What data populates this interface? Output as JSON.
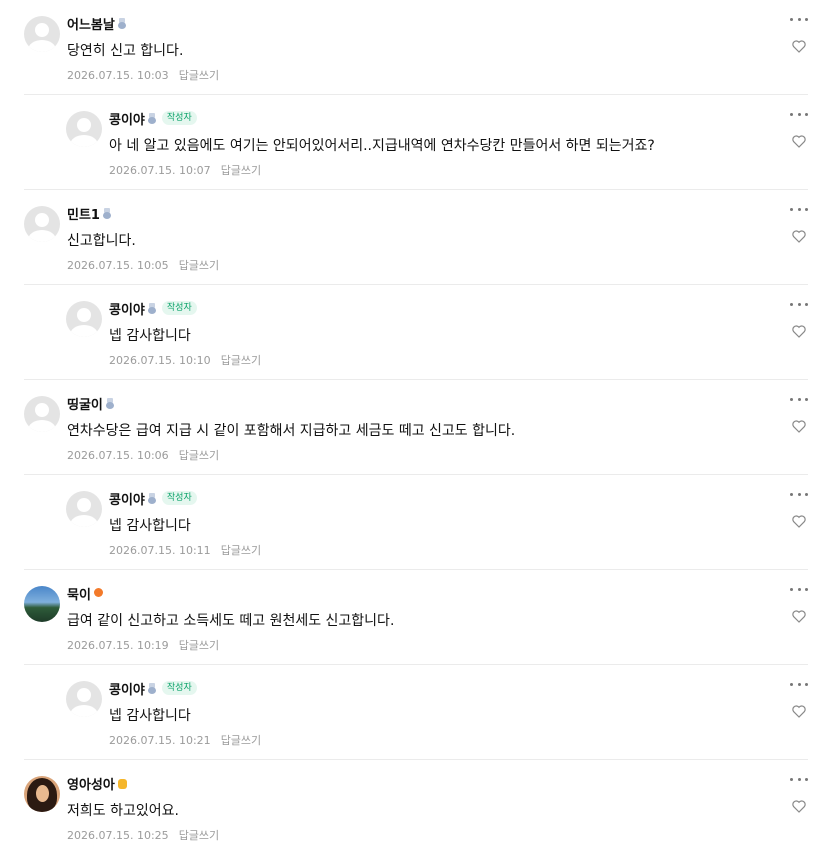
{
  "reply_label": "답글쓰기",
  "author_tag": "작성자",
  "comments": [
    {
      "author": "어느봄날",
      "badge": "blue",
      "avatar": "default",
      "text": "당연히 신고 합니다.",
      "date": "2026.07.15. 10:03"
    },
    {
      "author": "콩이야",
      "badge": "blue",
      "avatar": "default",
      "is_author": true,
      "text": "아 네 알고 있음에도 여기는 안되어있어서리..지급내역에 연차수당칸 만들어서 하면 되는거죠?",
      "date": "2026.07.15. 10:07"
    },
    {
      "author": "민트1",
      "badge": "blue",
      "avatar": "default",
      "text": "신고합니다.",
      "date": "2026.07.15. 10:05"
    },
    {
      "author": "콩이야",
      "badge": "blue",
      "avatar": "default",
      "is_author": true,
      "text": "넵 감사합니다",
      "date": "2026.07.15. 10:10"
    },
    {
      "author": "띵굴이",
      "badge": "blue",
      "avatar": "default",
      "text": "연차수당은 급여 지급 시 같이 포함해서 지급하고 세금도 떼고 신고도 합니다.",
      "date": "2026.07.15. 10:06"
    },
    {
      "author": "콩이야",
      "badge": "blue",
      "avatar": "default",
      "is_author": true,
      "text": "넵 감사합니다",
      "date": "2026.07.15. 10:11"
    },
    {
      "author": "묵이",
      "badge": "orange",
      "avatar": "scenic",
      "text": "급여 같이 신고하고 소득세도 떼고 원천세도 신고합니다.",
      "date": "2026.07.15. 10:19"
    },
    {
      "author": "콩이야",
      "badge": "blue",
      "avatar": "default",
      "is_author": true,
      "text": "넵 감사합니다",
      "date": "2026.07.15. 10:21"
    },
    {
      "author": "영아성아",
      "badge": "yellow",
      "avatar": "portrait",
      "text": "저희도 하고있어요.",
      "date": "2026.07.15. 10:25"
    }
  ],
  "icons": {
    "more": "more-dots-icon",
    "like": "heart-icon"
  }
}
